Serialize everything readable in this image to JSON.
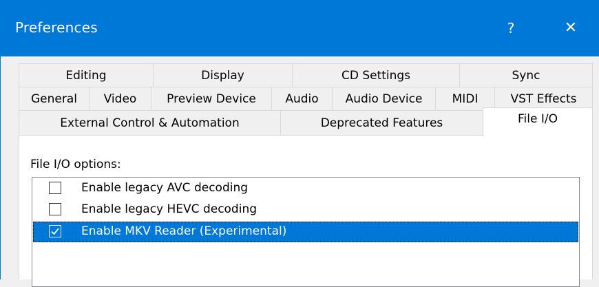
{
  "window": {
    "title": "Preferences",
    "help_glyph": "?",
    "close_glyph": "✕"
  },
  "tabs": {
    "row1": [
      "Editing",
      "Display",
      "CD Settings",
      "Sync"
    ],
    "row2": [
      "General",
      "Video",
      "Preview Device",
      "Audio",
      "Audio Device",
      "MIDI",
      "VST Effects"
    ],
    "row3": [
      "External Control & Automation",
      "Deprecated Features",
      "File I/O"
    ],
    "selected": "File I/O"
  },
  "file_io": {
    "options_label": "File I/O options:",
    "options": [
      {
        "label": "Enable legacy AVC decoding",
        "checked": false,
        "selected": false
      },
      {
        "label": "Enable legacy HEVC decoding",
        "checked": false,
        "selected": false
      },
      {
        "label": "Enable MKV Reader (Experimental)",
        "checked": true,
        "selected": true
      }
    ]
  },
  "colors": {
    "accent": "#0078d7",
    "window_bg": "#f0f0f0",
    "tab_border": "#d9d9d9"
  }
}
